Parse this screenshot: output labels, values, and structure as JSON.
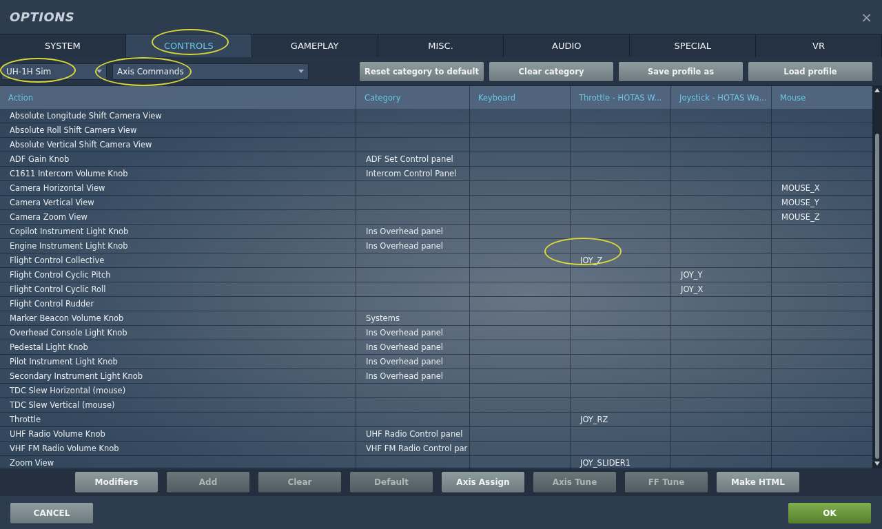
{
  "window": {
    "title": "OPTIONS",
    "close": "×"
  },
  "tabs": [
    {
      "label": "SYSTEM",
      "selected": false
    },
    {
      "label": "CONTROLS",
      "selected": true
    },
    {
      "label": "GAMEPLAY",
      "selected": false
    },
    {
      "label": "MISC.",
      "selected": false
    },
    {
      "label": "AUDIO",
      "selected": false
    },
    {
      "label": "SPECIAL",
      "selected": false
    },
    {
      "label": "VR",
      "selected": false
    }
  ],
  "aircraft_dropdown": {
    "value": "UH-1H Sim"
  },
  "category_dropdown": {
    "value": "Axis Commands"
  },
  "toolbar_buttons": [
    {
      "label": "Reset category to default",
      "disabled": false
    },
    {
      "label": "Clear category",
      "disabled": false
    },
    {
      "label": "Save profile as",
      "disabled": false
    },
    {
      "label": "Load profile",
      "disabled": false
    }
  ],
  "table": {
    "columns": [
      "Action",
      "Category",
      "Keyboard",
      "Throttle - HOTAS W...",
      "Joystick - HOTAS Wa...",
      "Mouse"
    ],
    "rows": [
      {
        "action": "Absolute Longitude Shift Camera View"
      },
      {
        "action": "Absolute Roll Shift Camera View"
      },
      {
        "action": "Absolute Vertical Shift Camera View"
      },
      {
        "action": "ADF Gain Knob",
        "category": "ADF Set Control panel"
      },
      {
        "action": "C1611 Intercom Volume Knob",
        "category": "Intercom Control Panel"
      },
      {
        "action": "Camera Horizontal View",
        "mouse": "MOUSE_X"
      },
      {
        "action": "Camera Vertical View",
        "mouse": "MOUSE_Y"
      },
      {
        "action": "Camera Zoom View",
        "mouse": "MOUSE_Z"
      },
      {
        "action": "Copilot Instrument Light Knob",
        "category": "Ins Overhead panel"
      },
      {
        "action": "Engine Instrument Light Knob",
        "category": "Ins Overhead panel"
      },
      {
        "action": "Flight Control Collective",
        "throttle": "JOY_Z"
      },
      {
        "action": "Flight Control Cyclic Pitch",
        "joystick": "JOY_Y"
      },
      {
        "action": "Flight Control Cyclic Roll",
        "joystick": "JOY_X"
      },
      {
        "action": "Flight Control Rudder"
      },
      {
        "action": "Marker Beacon Volume Knob",
        "category": "Systems"
      },
      {
        "action": "Overhead Console Light Knob",
        "category": "Ins Overhead panel"
      },
      {
        "action": "Pedestal Light Knob",
        "category": "Ins Overhead panel"
      },
      {
        "action": "Pilot Instrument Light Knob",
        "category": "Ins Overhead panel"
      },
      {
        "action": "Secondary Instrument Light Knob",
        "category": "Ins Overhead panel"
      },
      {
        "action": "TDC Slew Horizontal (mouse)"
      },
      {
        "action": "TDC Slew Vertical (mouse)"
      },
      {
        "action": "Throttle",
        "throttle": "JOY_RZ"
      },
      {
        "action": "UHF Radio Volume Knob",
        "category": "UHF Radio Control panel"
      },
      {
        "action": "VHF FM Radio Volume Knob",
        "category": "VHF FM Radio Control par"
      },
      {
        "action": "Zoom View",
        "throttle": "JOY_SLIDER1"
      }
    ]
  },
  "bottom_buttons": [
    {
      "label": "Modifiers",
      "disabled": false
    },
    {
      "label": "Add",
      "disabled": true
    },
    {
      "label": "Clear",
      "disabled": true
    },
    {
      "label": "Default",
      "disabled": true
    },
    {
      "label": "Axis Assign",
      "disabled": false
    },
    {
      "label": "Axis Tune",
      "disabled": true
    },
    {
      "label": "FF Tune",
      "disabled": true
    },
    {
      "label": "Make HTML",
      "disabled": false
    }
  ],
  "footer": {
    "cancel": "CANCEL",
    "ok": "OK"
  }
}
